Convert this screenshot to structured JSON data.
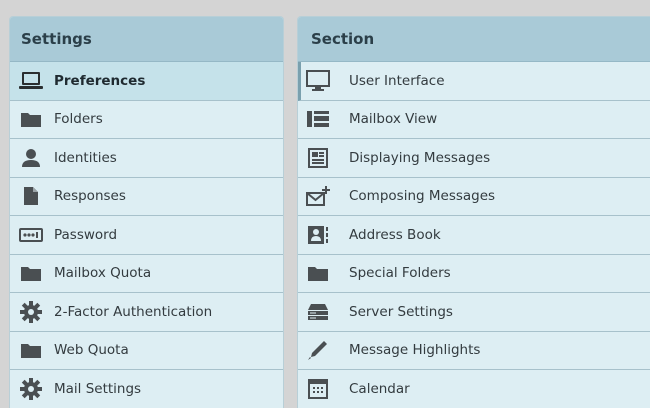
{
  "settings": {
    "header": "Settings",
    "items": [
      {
        "label": "Preferences",
        "icon": "laptop-icon",
        "selected": true
      },
      {
        "label": "Folders",
        "icon": "folder-icon"
      },
      {
        "label": "Identities",
        "icon": "user-icon"
      },
      {
        "label": "Responses",
        "icon": "document-icon"
      },
      {
        "label": "Password",
        "icon": "password-icon"
      },
      {
        "label": "Mailbox Quota",
        "icon": "folder-icon"
      },
      {
        "label": "2-Factor Authentication",
        "icon": "gear-icon"
      },
      {
        "label": "Web Quota",
        "icon": "folder-icon"
      },
      {
        "label": "Mail Settings",
        "icon": "gear-icon"
      }
    ]
  },
  "section": {
    "header": "Section",
    "items": [
      {
        "label": "User Interface",
        "icon": "monitor-icon",
        "selected": true
      },
      {
        "label": "Mailbox View",
        "icon": "mailbox-view-icon"
      },
      {
        "label": "Displaying Messages",
        "icon": "message-display-icon"
      },
      {
        "label": "Composing Messages",
        "icon": "compose-icon"
      },
      {
        "label": "Address Book",
        "icon": "address-book-icon"
      },
      {
        "label": "Special Folders",
        "icon": "folder-icon"
      },
      {
        "label": "Server Settings",
        "icon": "server-icon"
      },
      {
        "label": "Message Highlights",
        "icon": "pen-icon"
      },
      {
        "label": "Calendar",
        "icon": "calendar-icon"
      }
    ]
  }
}
